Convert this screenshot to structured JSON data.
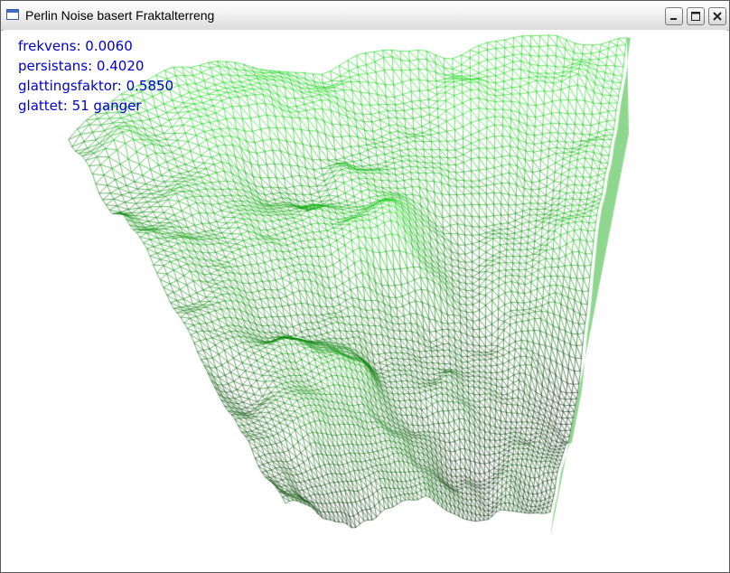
{
  "window": {
    "title": "Perlin Noise basert Fraktalterreng",
    "icon": "window-icon",
    "buttons": [
      "minimize-icon",
      "maximize-icon",
      "close-icon"
    ]
  },
  "hud": {
    "frekvens": "frekvens: 0.0060",
    "persistans": "persistans: 0.4020",
    "glattingsfaktor": "glattingsfaktor: 0.5850",
    "glattet": "glattet: 51 ganger"
  },
  "colors": {
    "hud_text": "#0000c8",
    "terrain_low": "#000000",
    "terrain_high": "#22cc22",
    "background": "#ffffff"
  }
}
